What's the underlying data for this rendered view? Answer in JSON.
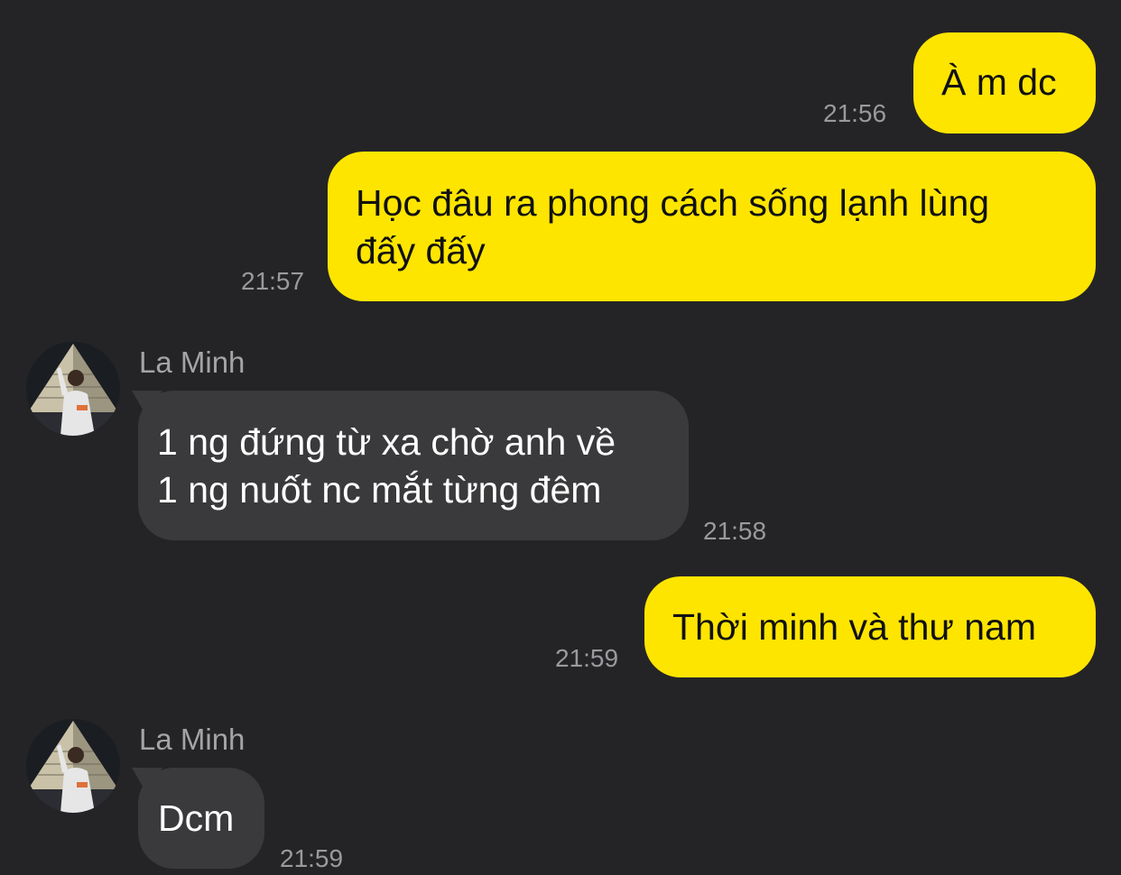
{
  "colors": {
    "background": "#242426",
    "outgoing_bubble": "#FEE500",
    "incoming_bubble": "#3A3A3C",
    "timestamp": "#9A9A9E",
    "sender_name": "#A4A4A8"
  },
  "messages": [
    {
      "direction": "outgoing",
      "text": "À m dc",
      "time": "21:56"
    },
    {
      "direction": "outgoing",
      "text": "Học đâu ra phong cách sống lạnh lùng\nđấy đấy",
      "time": "21:57"
    },
    {
      "direction": "incoming",
      "sender": "La Minh",
      "avatar_icon": "user-photo-avatar",
      "text": "1 ng đứng từ xa chờ anh về\n1 ng nuốt nc mắt từng đêm",
      "time": "21:58"
    },
    {
      "direction": "outgoing",
      "text": "Thời minh và thư nam",
      "time": "21:59"
    },
    {
      "direction": "incoming",
      "sender": "La Minh",
      "avatar_icon": "user-photo-avatar",
      "text": "Dcm",
      "time": "21:59"
    }
  ]
}
